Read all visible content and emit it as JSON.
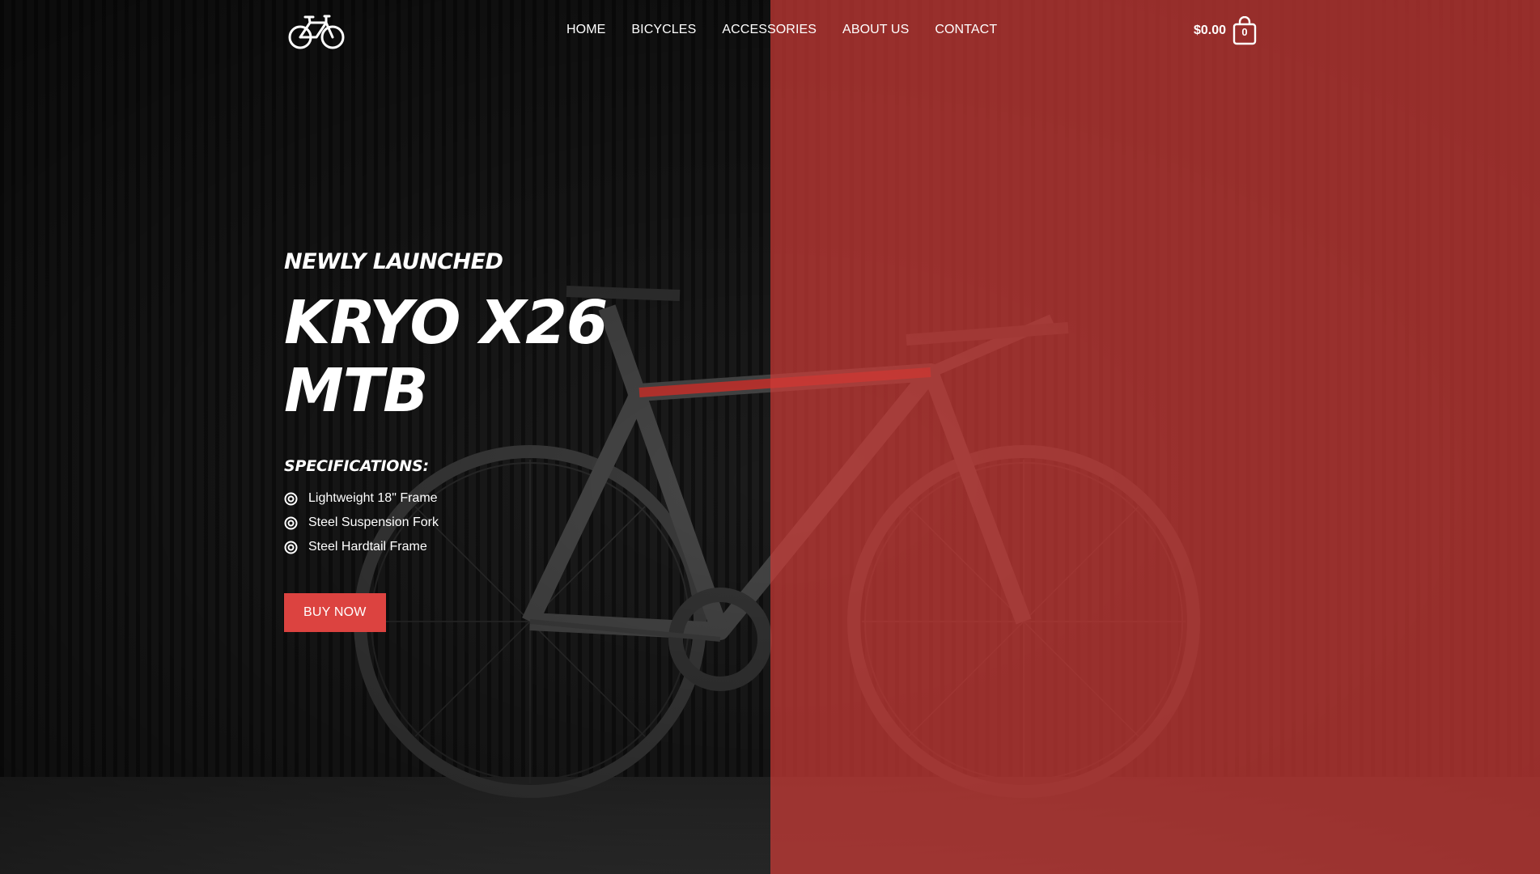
{
  "header": {
    "logo_icon": "bicycle-icon",
    "nav": [
      {
        "label": "HOME"
      },
      {
        "label": "BICYCLES"
      },
      {
        "label": "ACCESSORIES"
      },
      {
        "label": "ABOUT US"
      },
      {
        "label": "CONTACT"
      }
    ],
    "cart": {
      "price": "$0.00",
      "count": "0",
      "icon": "shopping-bag-icon"
    }
  },
  "hero": {
    "eyebrow": "NEWLY LAUNCHED",
    "title_line1": "KRYO X26",
    "title_line2": "MTB",
    "specs_heading": "SPECIFICATIONS:",
    "specs": [
      {
        "label": "Lightweight 18\" Frame",
        "icon": "target-icon"
      },
      {
        "label": "Steel Suspension Fork",
        "icon": "target-icon"
      },
      {
        "label": "Steel Hardtail Frame",
        "icon": "target-icon"
      }
    ],
    "cta_label": "BUY NOW"
  },
  "colors": {
    "accent": "#dc4340",
    "overlay_red": "#cd3c37",
    "background_dark": "#141414"
  }
}
